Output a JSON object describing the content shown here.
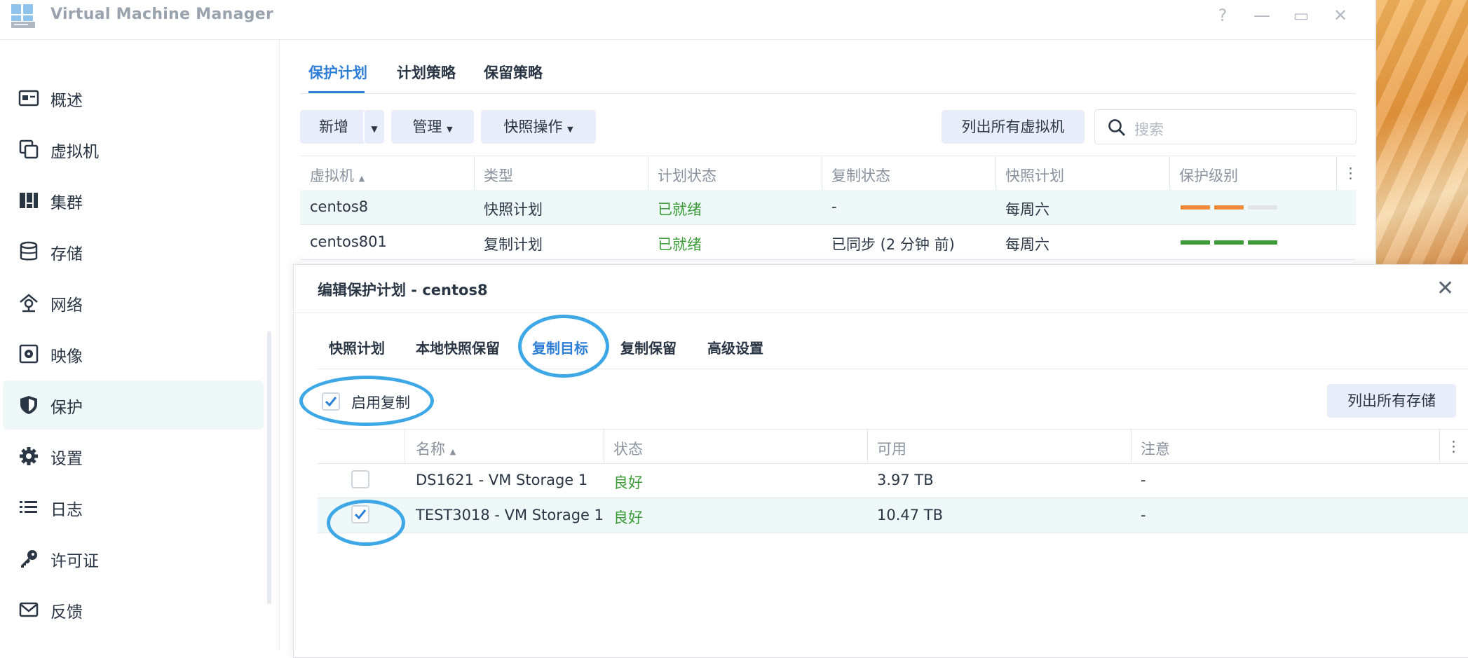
{
  "window": {
    "title": "Virtual Machine Manager",
    "controls": [
      "?",
      "—",
      "▭",
      "✕"
    ]
  },
  "sidebar": {
    "items": [
      {
        "label": "概述",
        "icon": "overview-icon"
      },
      {
        "label": "虚拟机",
        "icon": "vm-icon"
      },
      {
        "label": "集群",
        "icon": "cluster-icon"
      },
      {
        "label": "存储",
        "icon": "storage-icon"
      },
      {
        "label": "网络",
        "icon": "network-icon"
      },
      {
        "label": "映像",
        "icon": "image-icon"
      },
      {
        "label": "保护",
        "icon": "shield-icon"
      },
      {
        "label": "设置",
        "icon": "gear-icon"
      },
      {
        "label": "日志",
        "icon": "log-list-icon"
      },
      {
        "label": "许可证",
        "icon": "key-icon"
      },
      {
        "label": "反馈",
        "icon": "mail-icon"
      }
    ],
    "active_index": 6
  },
  "main": {
    "tabs": [
      "保护计划",
      "计划策略",
      "保留策略"
    ],
    "toolbar": {
      "add": "新增",
      "manage": "管理",
      "snapshot_ops": "快照操作",
      "list_all_vms": "列出所有虚拟机",
      "search_placeholder": "搜索"
    },
    "columns": [
      "虚拟机",
      "类型",
      "计划状态",
      "复制状态",
      "快照计划",
      "保护级别"
    ],
    "rows": [
      {
        "vm": "centos8",
        "type": "快照计划",
        "plan_status": "已就绪",
        "repl_status": "-",
        "schedule": "每周六",
        "level": [
          1,
          1,
          0
        ]
      },
      {
        "vm": "centos801",
        "type": "复制计划",
        "plan_status": "已就绪",
        "repl_status": "已同步 (2 分钟 前)",
        "schedule": "每周六",
        "level": [
          1,
          1,
          1
        ]
      }
    ]
  },
  "dialog": {
    "title": "编辑保护计划 - centos8",
    "tabs": [
      "快照计划",
      "本地快照保留",
      "复制目标",
      "复制保留",
      "高级设置"
    ],
    "active_tab": 2,
    "enable_replication_label": "启用复制",
    "enable_replication_checked": true,
    "list_all_storage": "列出所有存储",
    "columns": [
      "名称",
      "状态",
      "可用",
      "注意"
    ],
    "rows": [
      {
        "checked": false,
        "name": "DS1621 - VM Storage 1",
        "status": "良好",
        "available": "3.97 TB",
        "note": "-"
      },
      {
        "checked": true,
        "name": "TEST3018 - VM Storage 1",
        "status": "良好",
        "available": "10.47 TB",
        "note": "-"
      }
    ]
  },
  "colors": {
    "accent": "#2f7fd6",
    "ok_green": "#3b9b37",
    "level_orange": "#ee8a3a",
    "level_green": "#3c9a36",
    "highlight_ring": "#3ea8e6"
  }
}
